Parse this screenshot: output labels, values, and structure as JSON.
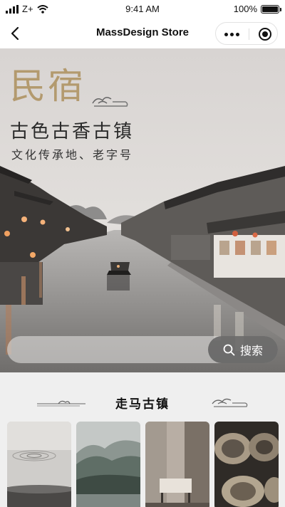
{
  "status_bar": {
    "carrier": "Z+",
    "time": "9:41 AM",
    "battery": "100%",
    "battery_level": 1.0
  },
  "nav": {
    "title": "MassDesign Store",
    "back_icon": "chevron-left-icon",
    "more_icon": "more-dots-icon",
    "close_icon": "target-icon"
  },
  "hero": {
    "title": "民宿",
    "subtitle": "古色古香古镇",
    "tagline": "文化传承地、老字号"
  },
  "search": {
    "value": "",
    "button_label": "搜索",
    "icon": "search-icon"
  },
  "section": {
    "title": "走马古镇",
    "thumbnails": [
      {
        "name": "water-ripple-thumbnail"
      },
      {
        "name": "mountain-mist-thumbnail"
      },
      {
        "name": "interior-chair-thumbnail"
      },
      {
        "name": "pottery-bowls-thumbnail"
      }
    ]
  },
  "colors": {
    "accent_gold": "#b39a6e",
    "page_background": "#efefef",
    "search_button": "#505050"
  }
}
